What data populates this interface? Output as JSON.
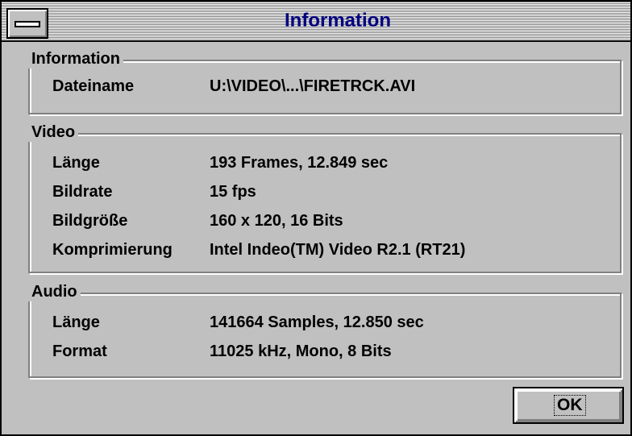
{
  "window": {
    "title": "Information"
  },
  "groups": [
    {
      "label": "Information",
      "rows": [
        {
          "label": "Dateiname",
          "value": "U:\\VIDEO\\...\\FIRETRCK.AVI"
        }
      ]
    },
    {
      "label": "Video",
      "rows": [
        {
          "label": "Länge",
          "value": "193 Frames, 12.849 sec"
        },
        {
          "label": "Bildrate",
          "value": "15 fps"
        },
        {
          "label": "Bildgröße",
          "value": "160 x 120, 16 Bits"
        },
        {
          "label": "Komprimierung",
          "value": "Intel Indeo(TM) Video R2.1 (RT21)"
        }
      ]
    },
    {
      "label": "Audio",
      "rows": [
        {
          "label": "Länge",
          "value": "141664 Samples, 12.850 sec"
        },
        {
          "label": "Format",
          "value": "11025 kHz, Mono, 8 Bits"
        }
      ]
    }
  ],
  "buttons": {
    "ok": "OK"
  },
  "colors": {
    "face": "#c0c0c0",
    "title_text": "#000080"
  }
}
